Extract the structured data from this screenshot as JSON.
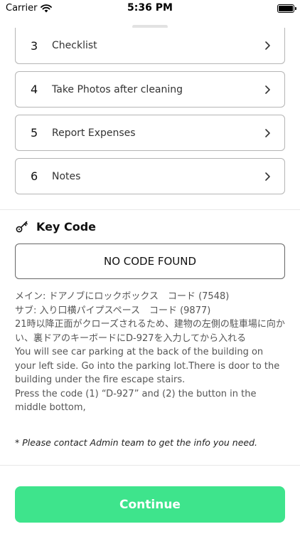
{
  "status_bar": {
    "carrier": "Carrier",
    "time": "5:36 PM",
    "wifi_icon": "wifi-icon",
    "battery_icon": "battery-icon"
  },
  "steps": [
    {
      "number": "3",
      "label": "Checklist"
    },
    {
      "number": "4",
      "label": "Take Photos after cleaning"
    },
    {
      "number": "5",
      "label": "Report Expenses"
    },
    {
      "number": "6",
      "label": "Notes"
    }
  ],
  "key_code": {
    "title": "Key Code",
    "icon": "key-icon",
    "code_value": "NO CODE FOUND"
  },
  "instructions": [
    "メイン: ドアノブにロックボックス　コード (7548)",
    "サブ: 入り口横パイプスペース　コード (9877)",
    "21時以降正面がクローズされるため、建物の左側の駐車場に向かい、裏ドアのキーボードにD-927を入力してから入れる",
    "You will see car parking at the back of the building on your left side. Go into the parking lot.There is door to the building under the fire escape stairs.",
    "Press the code (1) “D-927” and (2) the button in the middle bottom,"
  ],
  "note": "* Please contact Admin team to get the info you need.",
  "continue_label": "Continue",
  "colors": {
    "accent": "#3ee48c",
    "border": "#b5b5b5",
    "text_muted": "#555555"
  }
}
